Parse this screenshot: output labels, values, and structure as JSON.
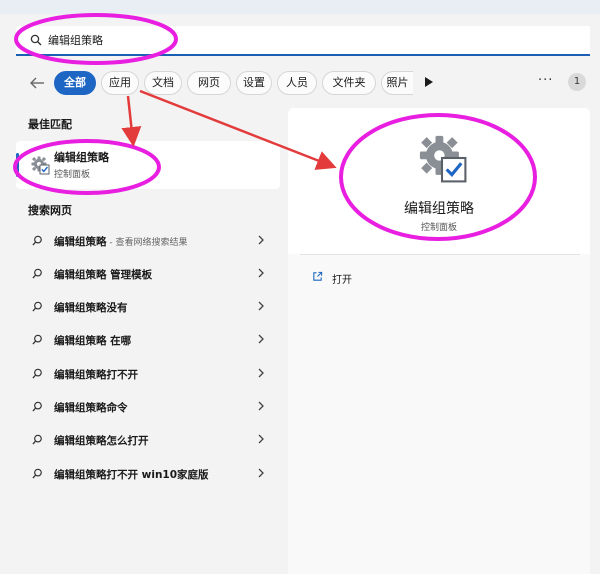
{
  "search": {
    "value": "编辑组策略"
  },
  "filters": {
    "tabs": [
      "全部",
      "应用",
      "文档",
      "网页",
      "设置",
      "人员",
      "文件夹",
      "照片"
    ],
    "more": "···",
    "badge": "1"
  },
  "best_match": {
    "section_title": "最佳匹配",
    "name": "编辑组策略",
    "subtitle": "控制面板",
    "icon": "gear-checkbox-icon"
  },
  "web_search": {
    "section_title": "搜索网页",
    "items": [
      {
        "text": "编辑组策略",
        "suffix": " - 查看网络搜索结果"
      },
      {
        "text": "编辑组策略 管理模板",
        "suffix": ""
      },
      {
        "text": "编辑组策略没有",
        "suffix": ""
      },
      {
        "text": "编辑组策略 在哪",
        "suffix": ""
      },
      {
        "text": "编辑组策略打不开",
        "suffix": ""
      },
      {
        "text": "编辑组策略命令",
        "suffix": ""
      },
      {
        "text": "编辑组策略怎么打开",
        "suffix": ""
      },
      {
        "text": "编辑组策略打不开 win10家庭版",
        "suffix": ""
      }
    ]
  },
  "detail": {
    "name": "编辑组策略",
    "subtitle": "控制面板",
    "actions": [
      {
        "label": "打开",
        "icon": "open-external-icon"
      }
    ]
  },
  "colors": {
    "accent": "#1e66c3",
    "annotation_circle": "#e81ee0",
    "annotation_arrow": "#e33b3b"
  }
}
